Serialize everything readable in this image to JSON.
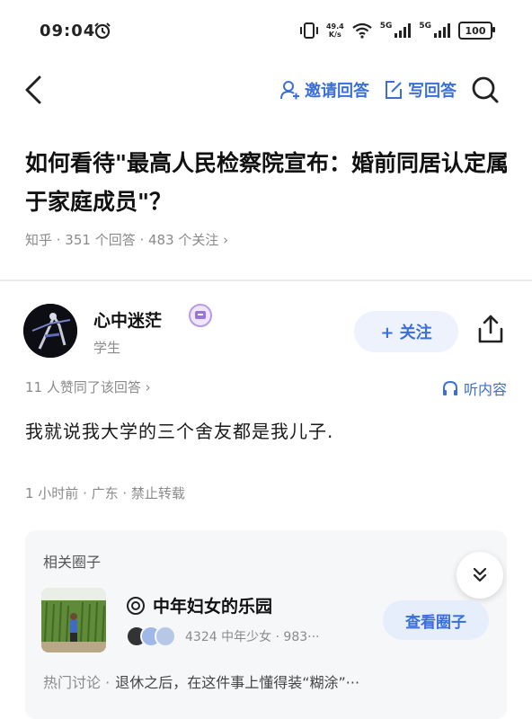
{
  "status_bar": {
    "time": "09:04",
    "speed_value": "49.4",
    "speed_unit": "K/s",
    "network1": "5G",
    "network2": "5G",
    "battery": "100"
  },
  "nav": {
    "invite_label": "邀请回答",
    "write_label": "写回答"
  },
  "question": {
    "title": "如何看待\"最高人民检察院宣布：婚前同居认定属于家庭成员\"？",
    "meta": "知乎 · 351 个回答 · 483 个关注 ›"
  },
  "author": {
    "name": "心中迷茫",
    "title": "学生",
    "follow_label": "+ 关注"
  },
  "answer": {
    "agree_line": "11 人赞同了该回答 ›",
    "listen_label": "听内容",
    "text": "我就说我大学的三个舍友都是我儿子.",
    "meta": "1 小时前 · 广东 · 禁止转载"
  },
  "related": {
    "label": "相关圈子",
    "circle_name": "中年妇女的乐园",
    "circle_stats": "4324 中年少女 · 983···",
    "view_label": "查看圈子",
    "hot_prefix": "热门讨论 ·",
    "hot_topic": "退休之后，在这件事上懂得装“糊涂”···"
  },
  "colors": {
    "accent": "#3b6fd8",
    "muted": "#8a8a8a"
  },
  "icons": [
    "alarm-icon",
    "vibrate-icon",
    "wifi-icon",
    "signal-icon",
    "battery-icon",
    "back-icon",
    "invite-icon",
    "edit-icon",
    "search-icon",
    "badge-icon",
    "share-icon",
    "headphone-icon",
    "chevron-down-double-icon",
    "circle-icon"
  ]
}
